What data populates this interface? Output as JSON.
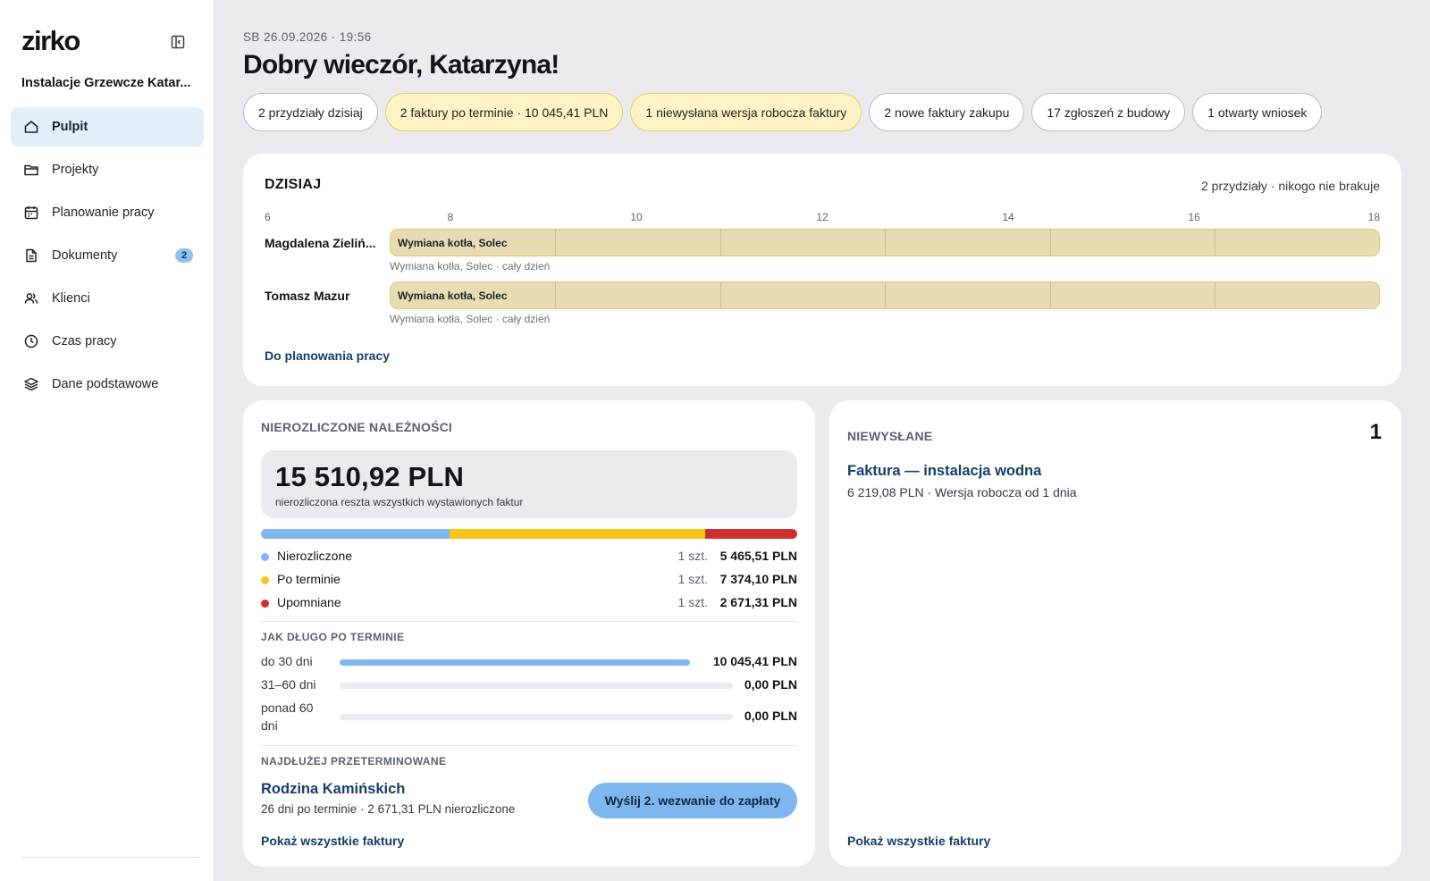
{
  "sidebar": {
    "logo": "zirko",
    "org_name": "Instalacje Grzewcze Katar...",
    "items": [
      {
        "label": "Pulpit",
        "icon": "home-icon",
        "active": true
      },
      {
        "label": "Projekty",
        "icon": "folder-icon"
      },
      {
        "label": "Planowanie pracy",
        "icon": "calendar-icon"
      },
      {
        "label": "Dokumenty",
        "icon": "document-icon",
        "badge": "2"
      },
      {
        "label": "Klienci",
        "icon": "users-icon"
      },
      {
        "label": "Czas pracy",
        "icon": "clock-icon"
      },
      {
        "label": "Dane podstawowe",
        "icon": "layers-icon"
      }
    ]
  },
  "header": {
    "datetime": "SB 26.09.2026 · 19:56",
    "greeting": "Dobry wieczór, Katarzyna!"
  },
  "chips": [
    {
      "label": "2 przydziały dzisiaj",
      "warn": false
    },
    {
      "label": "2 faktury po terminie · 10 045,41 PLN",
      "warn": true
    },
    {
      "label": "1 niewysłana wersja robocza faktury",
      "warn": true
    },
    {
      "label": "2 nowe faktury zakupu",
      "warn": false
    },
    {
      "label": "17 zgłoszeń z budowy",
      "warn": false
    },
    {
      "label": "1 otwarty wniosek",
      "warn": false
    }
  ],
  "today": {
    "title": "DZISIAJ",
    "summary": "2 przydziały · nikogo nie brakuje",
    "axis_ticks": [
      "6",
      "8",
      "10",
      "12",
      "14",
      "16",
      "18"
    ],
    "axis_start_hour": 6,
    "axis_end_hour": 18,
    "rows": [
      {
        "name": "Magdalena Zieliń...",
        "label": "Wymiana kotła, Solec",
        "sub": "Wymiana kotła, Solec · cały dzień"
      },
      {
        "name": "Tomasz Mazur",
        "label": "Wymiana kotła, Solec",
        "sub": "Wymiana kotła, Solec · cały dzień"
      }
    ],
    "link": "Do planowania pracy"
  },
  "receivables": {
    "title": "NIEROZLICZONE NALEŻNOŚCI",
    "total": "15 510,92 PLN",
    "total_sub": "nierozliczona reszta wszystkich wystawionych faktur",
    "categories": [
      {
        "name": "Nierozliczone",
        "count": "1 szt.",
        "amount": "5 465,51 PLN",
        "value": 5465.51,
        "color": "#7eb7ee"
      },
      {
        "name": "Po terminie",
        "count": "1 szt.",
        "amount": "7 374,10 PLN",
        "value": 7374.1,
        "color": "#f5c518"
      },
      {
        "name": "Upomniane",
        "count": "1 szt.",
        "amount": "2 671,31 PLN",
        "value": 2671.31,
        "color": "#d12f2f"
      }
    ],
    "aging_title": "JAK DŁUGO PO TERMINIE",
    "aging": [
      {
        "name": "do 30 dni",
        "amount": "10 045,41 PLN",
        "fraction": 1.0
      },
      {
        "name": "31–60 dni",
        "amount": "0,00 PLN",
        "fraction": 0
      },
      {
        "name": "ponad 60 dni",
        "amount": "0,00 PLN",
        "fraction": 0
      }
    ],
    "longest_title": "NAJDŁUŻEJ PRZETERMINOWANE",
    "longest_client": "Rodzina Kamińskich",
    "longest_sub": "26 dni po terminie · 2 671,31 PLN nierozliczone",
    "remind_button": "Wyślij 2. wezwanie do zapłaty",
    "link": "Pokaż wszystkie faktury"
  },
  "unsent": {
    "title": "NIEWYSŁANE",
    "count": "1",
    "invoice_title": "Faktura — instalacja wodna",
    "invoice_sub": "6 219,08 PLN · Wersja robocza od 1 dnia",
    "link": "Pokaż wszystkie faktury"
  }
}
